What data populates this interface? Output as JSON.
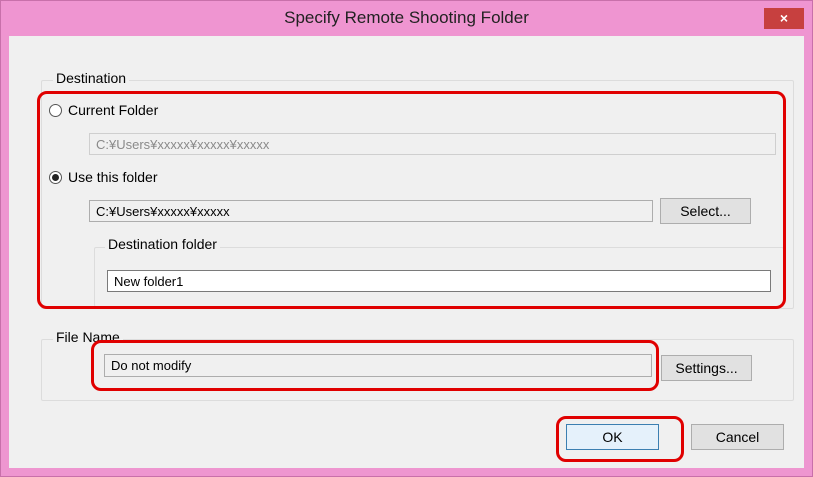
{
  "window": {
    "title": "Specify Remote Shooting Folder",
    "close_glyph": "×"
  },
  "destination": {
    "group_label": "Destination",
    "current_folder_label": "Current Folder",
    "current_folder_path": "C:¥Users¥xxxxx¥xxxxx¥xxxxx",
    "use_this_folder_label": "Use this folder",
    "use_this_folder_path": "C:¥Users¥xxxxx¥xxxxx",
    "selected_option": "Use this folder",
    "select_button": "Select...",
    "dest_folder_group_label": "Destination folder",
    "dest_folder_value": "New folder1"
  },
  "file_name": {
    "group_label": "File Name",
    "value": "Do not modify",
    "settings_button": "Settings..."
  },
  "footer": {
    "ok_button": "OK",
    "cancel_button": "Cancel"
  },
  "colors": {
    "titlebar": "#ef95d1",
    "close_button": "#c7403f",
    "highlight": "#e00000",
    "dialog_bg": "#f0f0f0"
  }
}
